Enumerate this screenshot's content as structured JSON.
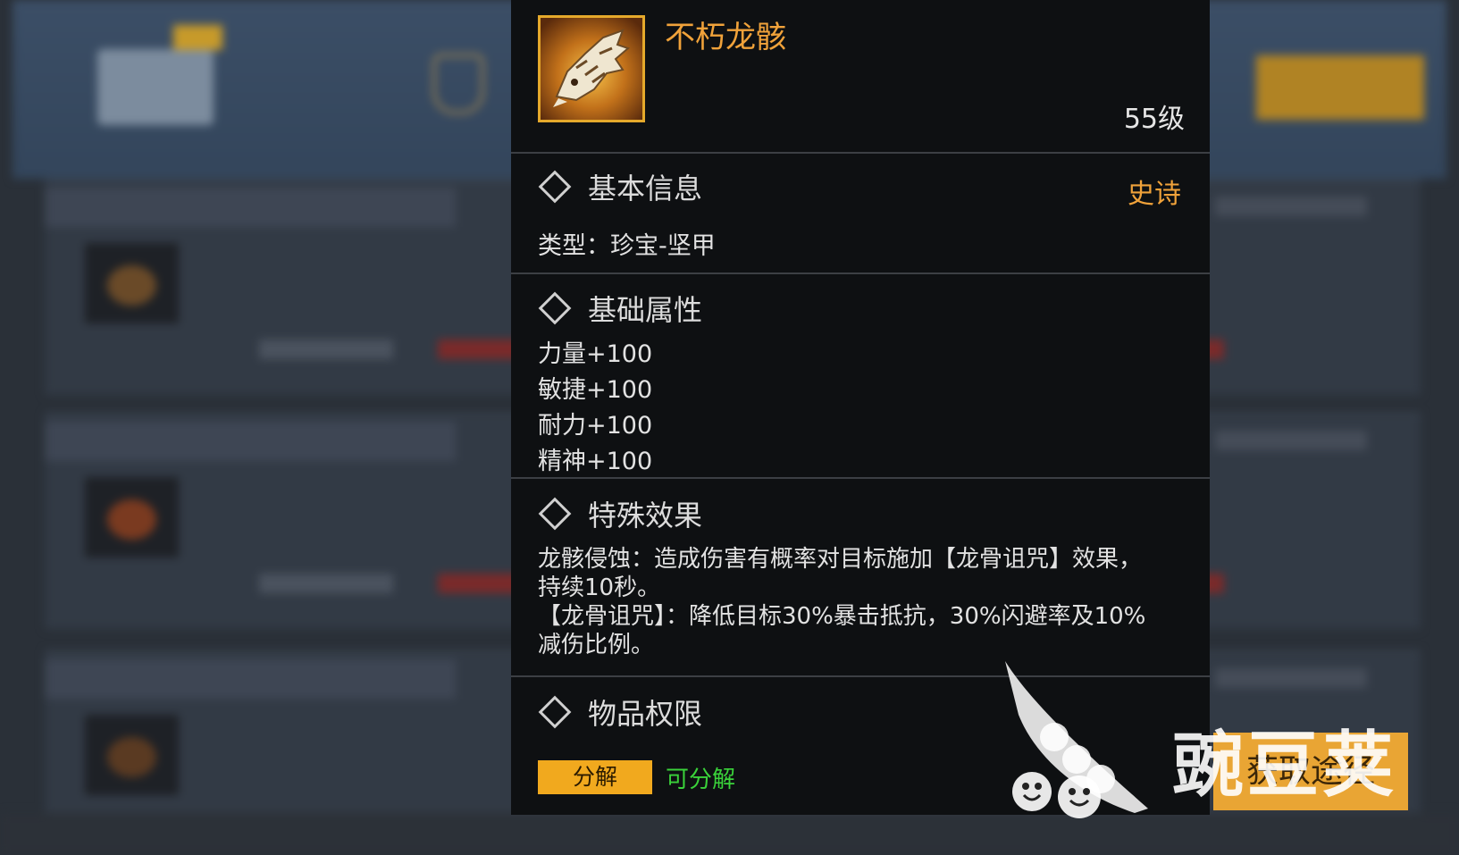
{
  "item": {
    "name": "不朽龙骸",
    "level": "55级",
    "icon": "dragon-skull-icon",
    "rarity": "史诗",
    "rarity_color": "#f0a23a"
  },
  "basic_info": {
    "title": "基本信息",
    "type_line": "类型：珍宝-坚甲"
  },
  "base_attributes": {
    "title": "基础属性",
    "stats": [
      "力量+100",
      "敏捷+100",
      "耐力+100",
      "精神+100"
    ]
  },
  "special_effect": {
    "title": "特殊效果",
    "lines": [
      "龙骸侵蚀：造成伤害有概率对目标施加【龙骨诅咒】效果，",
      "持续10秒。",
      "【龙骨诅咒】：降低目标30%暴击抵抗，30%闪避率及10%",
      "减伤比例。"
    ]
  },
  "permissions": {
    "title": "物品权限",
    "decompose_label": "分解",
    "decompose_status": "可分解"
  },
  "get_source_label": "获取途径",
  "watermark": "豌豆荚"
}
